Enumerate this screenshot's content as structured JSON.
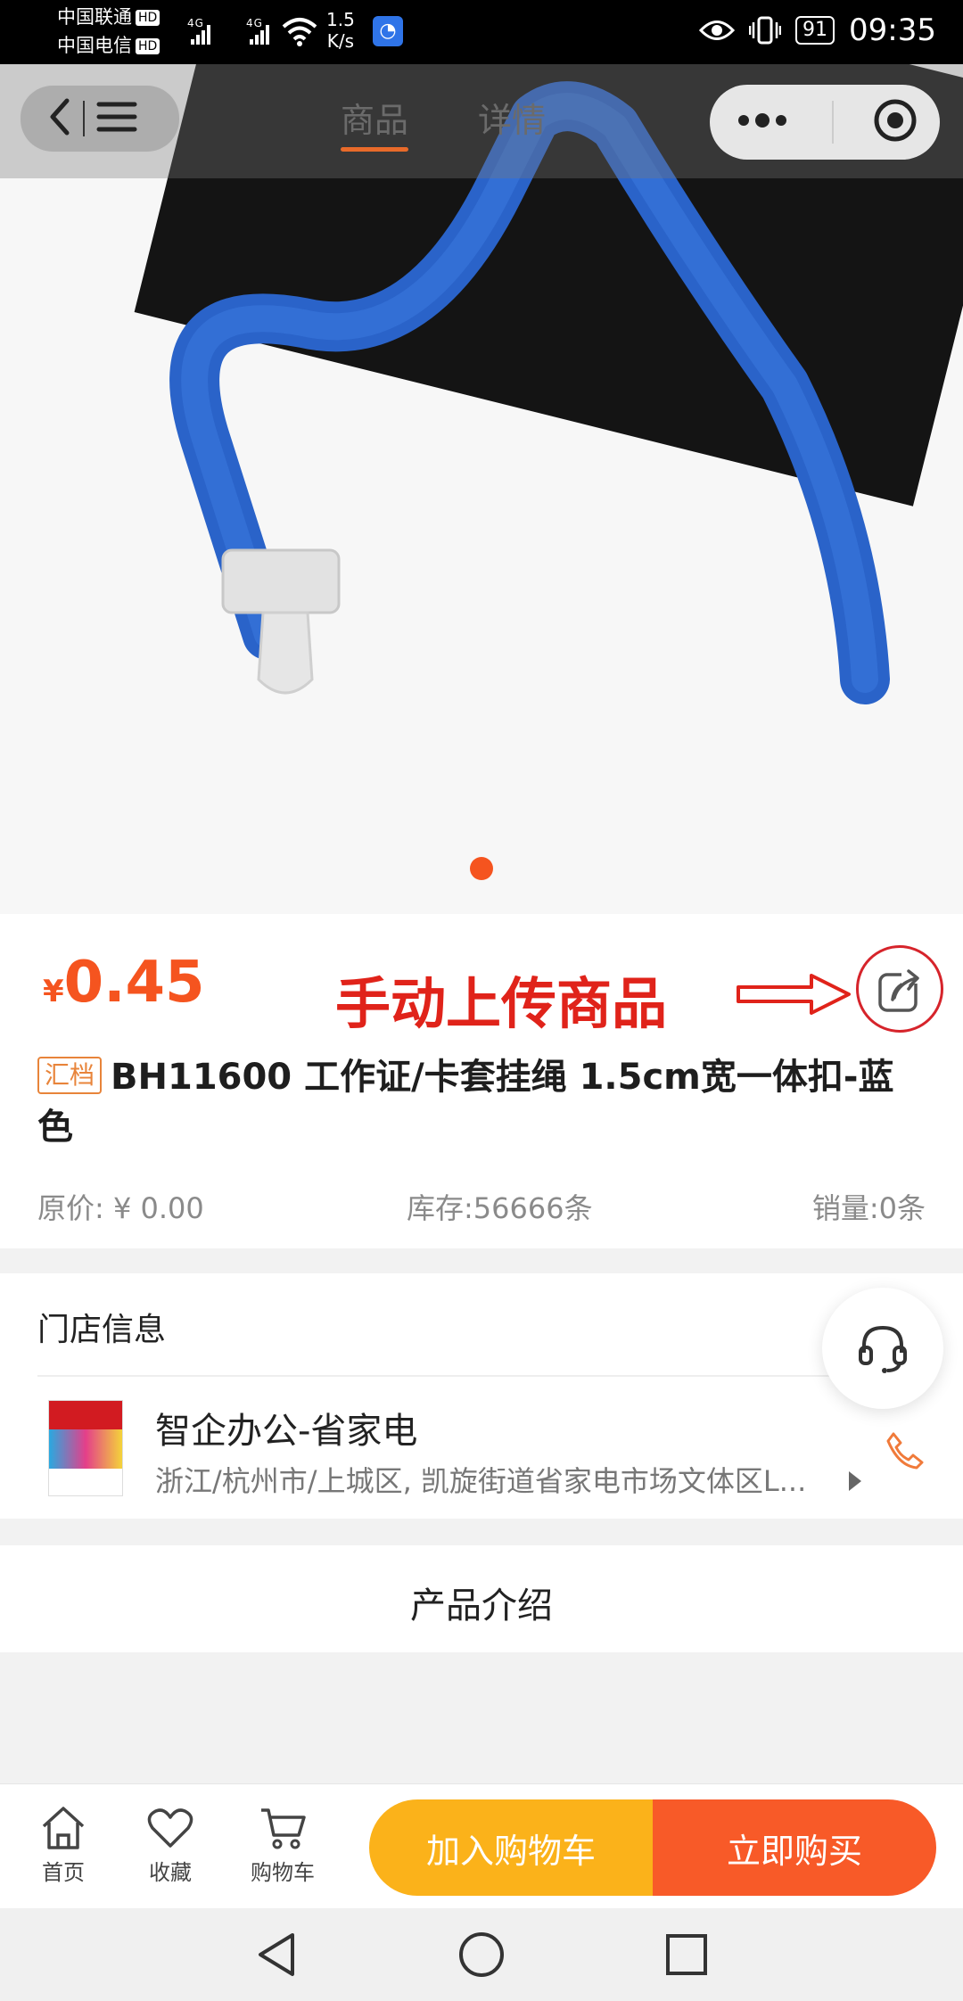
{
  "status_bar": {
    "carrier1": "中国联通",
    "carrier2": "中国电信",
    "hd": "HD",
    "network": "4G",
    "speed_value": "1.5",
    "speed_unit": "K/s",
    "battery": "91",
    "time": "09:35"
  },
  "header": {
    "tabs": [
      {
        "label": "商品",
        "active": true
      },
      {
        "label": "详情",
        "active": false
      }
    ]
  },
  "gallery": {
    "current_index": 1,
    "total": 1
  },
  "product": {
    "currency": "¥",
    "price": "0.45",
    "annotation": "手动上传商品",
    "tag": "汇档",
    "title": "BH11600 工作证/卡套挂绳 1.5cm宽一体扣-蓝色",
    "original_price": "原价: ¥ 0.00",
    "stock": "库存:56666条",
    "sales": "销量:0条"
  },
  "store": {
    "section_title": "门店信息",
    "name": "智企办公-省家电",
    "address": "浙江/杭州市/上城区, 凯旋街道省家电市场文体区L..."
  },
  "intro": {
    "title": "产品介绍"
  },
  "bottom_nav": {
    "items": [
      {
        "label": "首页",
        "icon": "home-icon"
      },
      {
        "label": "收藏",
        "icon": "heart-icon"
      },
      {
        "label": "购物车",
        "icon": "cart-icon"
      }
    ],
    "add_to_cart": "加入购物车",
    "buy_now": "立即购买"
  },
  "colors": {
    "accent": "#f5541f",
    "cart_button": "#fbb21a",
    "buy_button": "#f85a28",
    "annotation": "#e0231a"
  }
}
